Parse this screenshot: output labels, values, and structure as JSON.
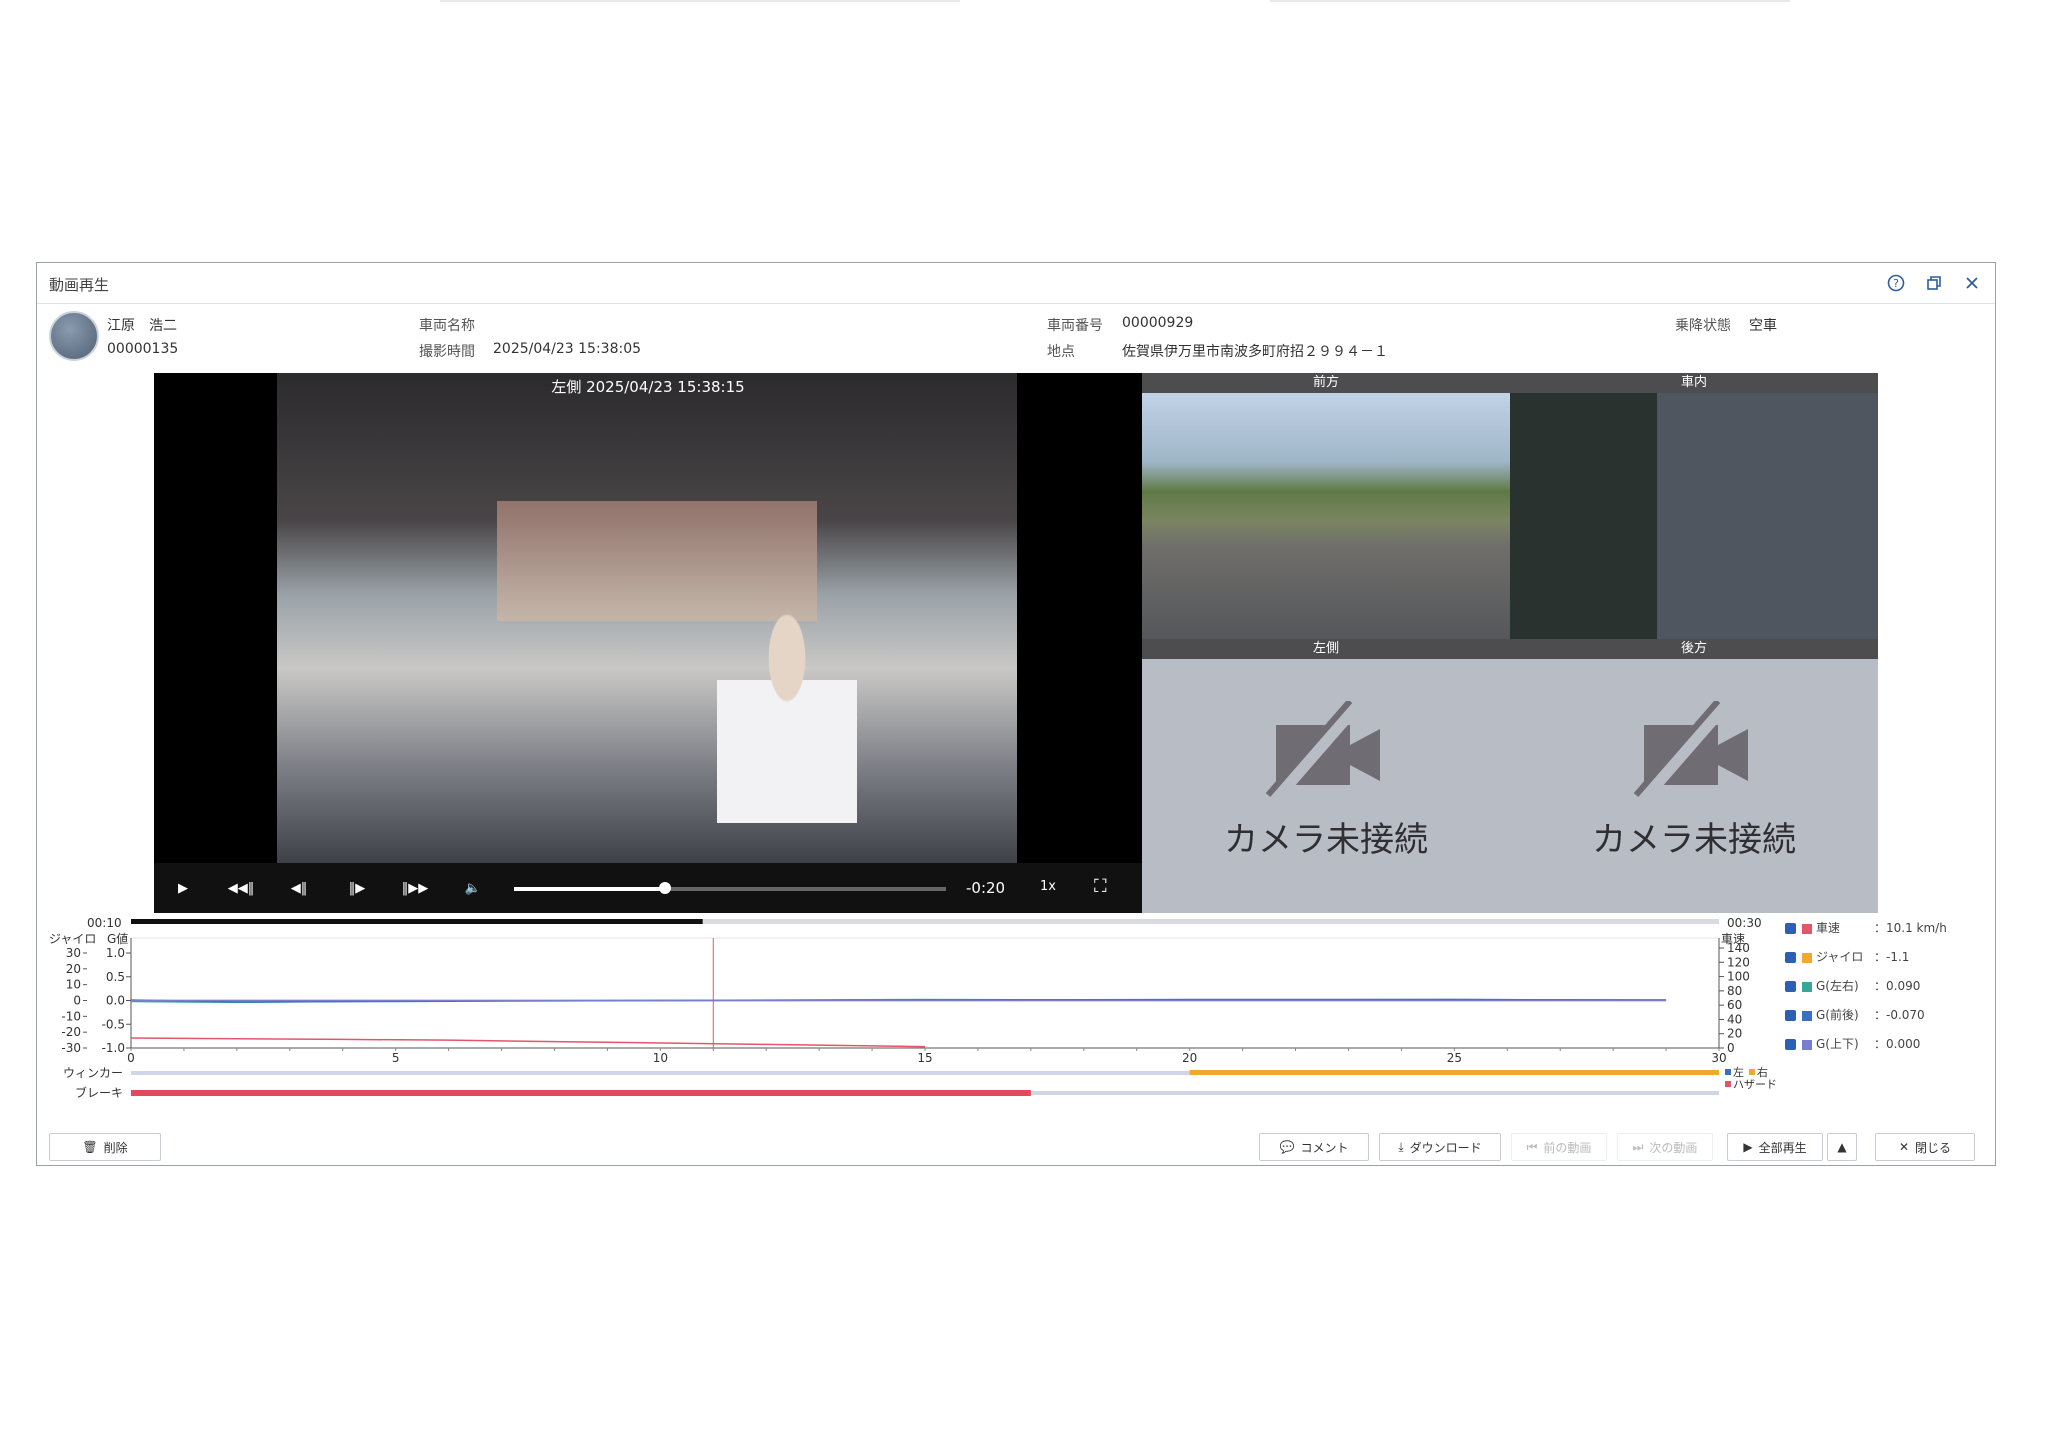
{
  "window": {
    "title": "動画再生"
  },
  "info": {
    "driver_name": "江原　浩二",
    "driver_id": "00000135",
    "vehicle_name_label": "車両名称",
    "shot_time_label": "撮影時間",
    "shot_time": "2025/04/23 15:38:05",
    "vehicle_number_label": "車両番号",
    "vehicle_number": "00000929",
    "location_label": "地点",
    "location": "佐賀県伊万里市南波多町府招２９９４－１",
    "status_label": "乗降状態",
    "status_value": "空車"
  },
  "main_video": {
    "caption": "左側 2025/04/23 15:38:15",
    "remaining": "-0:20",
    "speed": "1x",
    "progress": 0.35
  },
  "cameras": {
    "front_label": "前方",
    "interior_label": "車内",
    "left_label": "左側",
    "rear_label": "後方",
    "not_connected": "カメラ未接続"
  },
  "timeline": {
    "start": "00:10",
    "end": "00:30",
    "progress": 0.36
  },
  "chart_data": {
    "type": "line",
    "x_ticks": [
      "0",
      "5",
      "10",
      "15",
      "20",
      "25",
      "30"
    ],
    "xlim": [
      0,
      30
    ],
    "left_axis_label": "ジャイロ",
    "left_axis_ticks": [
      "30",
      "20",
      "10",
      "0",
      "-10",
      "-20",
      "-30"
    ],
    "g_axis_label": "G値",
    "g_axis_ticks": [
      "1.0",
      "0.5",
      "0.0",
      "-0.5",
      "-1.0"
    ],
    "right_axis_label": "車速",
    "right_axis_ticks": [
      "140",
      "120",
      "100",
      "80",
      "60",
      "40",
      "20",
      "0"
    ],
    "cursor_x": 11,
    "series": [
      {
        "name": "車速",
        "color": "#e2566a",
        "x": [
          0,
          2,
          4,
          6,
          8,
          10,
          12,
          14,
          15
        ],
        "values": [
          14,
          13,
          12,
          11,
          9,
          7,
          5,
          3,
          2
        ]
      },
      {
        "name": "ジャイロ",
        "color": "#f0a830",
        "x": [
          0,
          5,
          10,
          15,
          20,
          25,
          29
        ],
        "values": [
          0,
          0,
          0,
          0,
          0,
          0,
          0
        ]
      },
      {
        "name": "G(左右)",
        "color": "#3aa69a",
        "x": [
          0,
          2,
          5,
          10,
          15,
          20,
          25,
          29
        ],
        "values": [
          -0.02,
          -0.04,
          -0.01,
          0.0,
          0.02,
          0.01,
          0.02,
          0.01
        ]
      },
      {
        "name": "G(前後)",
        "color": "#3a6fc4",
        "x": [
          0,
          2,
          5,
          10,
          15,
          20,
          25,
          29
        ],
        "values": [
          0.01,
          -0.03,
          -0.02,
          0.0,
          0.01,
          0.02,
          0.02,
          0.01
        ]
      },
      {
        "name": "G(上下)",
        "color": "#7a7ed0",
        "x": [
          0,
          5,
          10,
          15,
          20,
          25,
          29
        ],
        "values": [
          0.0,
          0.0,
          0.0,
          0.0,
          0.0,
          0.0,
          0.0
        ]
      }
    ]
  },
  "legend": [
    {
      "name": "車速",
      "value": "10.1 km/h",
      "color": "#e2566a"
    },
    {
      "name": "ジャイロ",
      "value": "-1.1",
      "color": "#f0a830"
    },
    {
      "name": "G(左右)",
      "value": "0.090",
      "color": "#3aa69a"
    },
    {
      "name": "G(前後)",
      "value": "-0.070",
      "color": "#3a6fc4"
    },
    {
      "name": "G(上下)",
      "value": "0.000",
      "color": "#7a7ed0"
    }
  ],
  "signals": {
    "winker_label": "ウィンカー",
    "brake_label": "ブレーキ",
    "winker_start": 20,
    "brake_end": 17,
    "left_label": "左",
    "right_label": "右",
    "hazard_label": "ハザード"
  },
  "footer": {
    "delete": "削除",
    "comment": "コメント",
    "download": "ダウンロード",
    "prev_label": "前の動画",
    "next_label": "次の動画",
    "play_all": "全部再生",
    "close": "閉じる"
  }
}
